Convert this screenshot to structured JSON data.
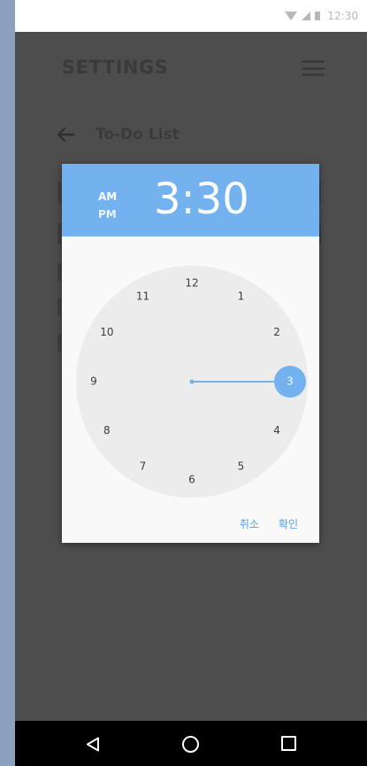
{
  "status_bar": {
    "time": "12:30"
  },
  "app": {
    "title": "SETTINGS",
    "subtitle": "To-Do List"
  },
  "time_picker": {
    "am_label": "AM",
    "pm_label": "PM",
    "hour": "3",
    "separator": ":",
    "minute": "30",
    "selected_hour": 3,
    "clock_numbers": [
      "12",
      "1",
      "2",
      "3",
      "4",
      "5",
      "6",
      "7",
      "8",
      "9",
      "10",
      "11"
    ],
    "cancel_label": "취소",
    "confirm_label": "확인"
  },
  "colors": {
    "accent": "#73b1ef",
    "hand": "#73b1ef",
    "dim_background": "#4d4d4d"
  },
  "icons": [
    "wifi-icon",
    "signal-icon",
    "battery-icon",
    "menu-icon",
    "back-arrow-icon",
    "nav-back-icon",
    "nav-home-icon",
    "nav-recent-icon"
  ]
}
